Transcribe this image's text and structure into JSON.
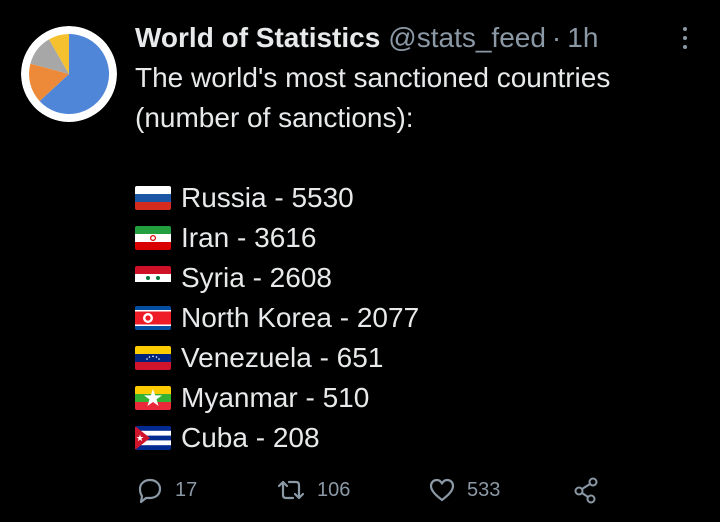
{
  "account": {
    "display_name": "World of Statistics",
    "handle": "@stats_feed",
    "separator": "·",
    "time": "1h",
    "avatar_icon": "pie-chart-avatar-icon"
  },
  "tweet": {
    "intro_line1": "The world's most sanctioned countries",
    "intro_line2": "(number of sanctions):",
    "items": [
      {
        "text": "Russia - 5530",
        "flag": "russia-flag-icon"
      },
      {
        "text": "Iran - 3616",
        "flag": "iran-flag-icon"
      },
      {
        "text": "Syria - 2608",
        "flag": "syria-flag-icon"
      },
      {
        "text": "North Korea - 2077",
        "flag": "north-korea-flag-icon"
      },
      {
        "text": "Venezuela - 651",
        "flag": "venezuela-flag-icon"
      },
      {
        "text": "Myanmar - 510",
        "flag": "myanmar-flag-icon"
      },
      {
        "text": "Cuba - 208",
        "flag": "cuba-flag-icon"
      }
    ]
  },
  "actions": {
    "reply_count": "17",
    "retweet_count": "106",
    "like_count": "533"
  },
  "colors": {
    "background": "#000000",
    "text": "#e7e9ea",
    "secondary": "#8b98a5"
  }
}
